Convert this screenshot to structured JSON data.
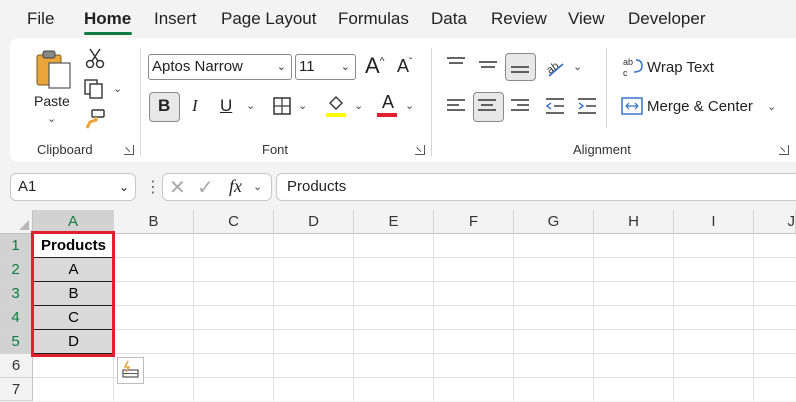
{
  "menu": {
    "items": [
      {
        "label": "File"
      },
      {
        "label": "Home"
      },
      {
        "label": "Insert"
      },
      {
        "label": "Page Layout"
      },
      {
        "label": "Formulas"
      },
      {
        "label": "Data"
      },
      {
        "label": "Review"
      },
      {
        "label": "View"
      },
      {
        "label": "Developer"
      }
    ],
    "active": "Home"
  },
  "ribbon": {
    "clipboard": {
      "paste_label": "Paste",
      "group_label": "Clipboard"
    },
    "font": {
      "font_name": "Aptos Narrow",
      "font_size": "11",
      "bold": "B",
      "italic": "I",
      "underline": "U",
      "grow": "A",
      "shrink": "A",
      "font_color_letter": "A",
      "group_label": "Font",
      "highlight_color": "#ffff00",
      "font_color": "#e0202e"
    },
    "alignment": {
      "wrap_text": "Wrap Text",
      "merge_center": "Merge & Center",
      "group_label": "Alignment"
    }
  },
  "formula_bar": {
    "name_box": "A1",
    "fx": "fx",
    "content": "Products"
  },
  "grid": {
    "columns": [
      "A",
      "B",
      "C",
      "D",
      "E",
      "F",
      "G",
      "H",
      "I",
      "J"
    ],
    "rows": [
      "1",
      "2",
      "3",
      "4",
      "5",
      "6",
      "7"
    ],
    "cells": [
      "Products",
      "A",
      "B",
      "C",
      "D"
    ],
    "selection_color": "#107c41",
    "highlight_color": "#e0202e"
  }
}
